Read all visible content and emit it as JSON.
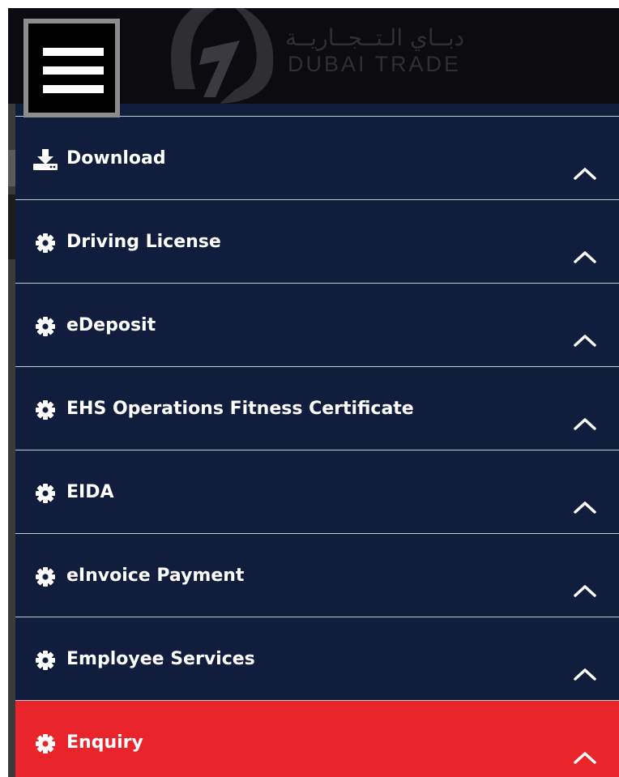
{
  "header": {
    "logo_arabic": "دبــاي الـتــجــاريــة",
    "logo_english": "DUBAI TRADE",
    "menu_toggle_icon": "hamburger-menu-icon"
  },
  "menu": {
    "items": [
      {
        "label": "Download",
        "icon": "download-icon",
        "chevron": "chevron-up-icon",
        "active": false
      },
      {
        "label": "Driving License",
        "icon": "gear-icon",
        "chevron": "chevron-up-icon",
        "active": false
      },
      {
        "label": "eDeposit",
        "icon": "gear-icon",
        "chevron": "chevron-up-icon",
        "active": false
      },
      {
        "label": "EHS Operations Fitness Certificate",
        "icon": "gear-icon",
        "chevron": "chevron-up-icon",
        "active": false
      },
      {
        "label": "EIDA",
        "icon": "gear-icon",
        "chevron": "chevron-up-icon",
        "active": false
      },
      {
        "label": "eInvoice Payment",
        "icon": "gear-icon",
        "chevron": "chevron-up-icon",
        "active": false
      },
      {
        "label": "Employee Services",
        "icon": "gear-icon",
        "chevron": "chevron-up-icon",
        "active": false
      },
      {
        "label": "Enquiry",
        "icon": "gear-icon",
        "chevron": "chevron-up-icon",
        "active": true
      }
    ]
  },
  "colors": {
    "menu_background": "#101d3d",
    "active_item": "#e9242b",
    "divider": "#c7cad2",
    "header_background": "#0b0b10"
  }
}
